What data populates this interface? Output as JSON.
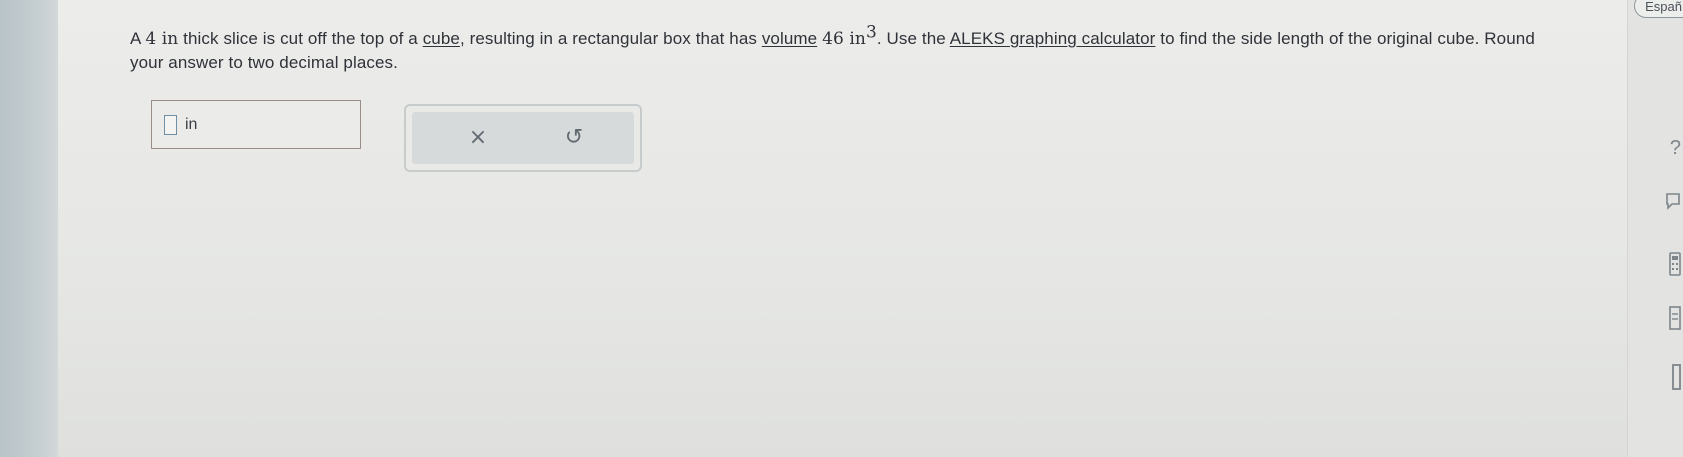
{
  "problem": {
    "part1": "A ",
    "slice_thickness": "4 in",
    "part2": " thick slice is cut off the top of a ",
    "cube_link": "cube",
    "part3": ", resulting in a rectangular box that has ",
    "volume_link": "volume",
    "volume_value": "46 in",
    "volume_exp": "3",
    "part4": ". Use the ",
    "calculator_link": "ALEKS graphing calculator",
    "part5": " to find the side length of the original cube. Round your answer to two decimal places."
  },
  "answer": {
    "value": "",
    "unit": "in"
  },
  "actions": {
    "clear_icon": "×",
    "undo_icon": "↺"
  },
  "sidebar": {
    "language_label": "Españ",
    "help_icon": "?",
    "icons": [
      "help-icon",
      "chat-icon",
      "calculator-icon",
      "book-icon",
      "notebook-icon"
    ]
  }
}
